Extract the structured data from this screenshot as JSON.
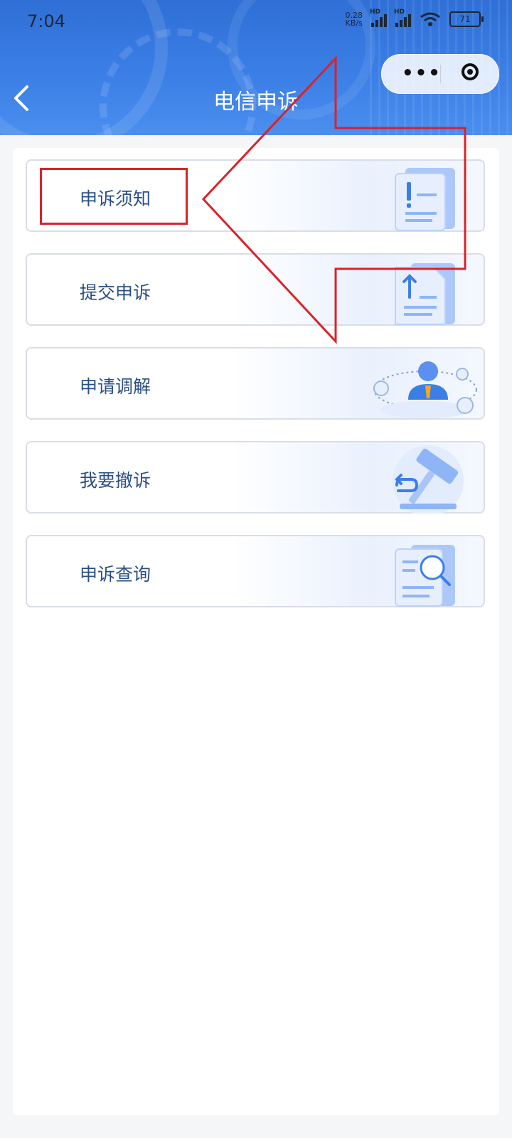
{
  "status_bar": {
    "time": "7:04",
    "net_speed_value": "0.28",
    "net_speed_unit": "KB/s",
    "signal1_label": "HD",
    "signal2_label": "HD",
    "battery": "71"
  },
  "header": {
    "title": "电信申诉",
    "back_icon": "chevron-left-icon",
    "more_icon": "more-dots-icon",
    "close_icon": "target-circle-icon"
  },
  "menu": {
    "items": [
      {
        "label": "申诉须知",
        "icon": "document-exclamation-icon"
      },
      {
        "label": "提交申诉",
        "icon": "document-upload-icon"
      },
      {
        "label": "申请调解",
        "icon": "mediator-person-icon"
      },
      {
        "label": "我要撤诉",
        "icon": "gavel-undo-icon"
      },
      {
        "label": "申诉查询",
        "icon": "document-search-icon"
      }
    ]
  },
  "annotation": {
    "highlight_color": "#d8232a",
    "arrow_color": "#d8232a"
  },
  "colors": {
    "header_blue": "#3b7fe6",
    "label_blue": "#2a4f86",
    "illus_blue": "#5b8ff0"
  }
}
